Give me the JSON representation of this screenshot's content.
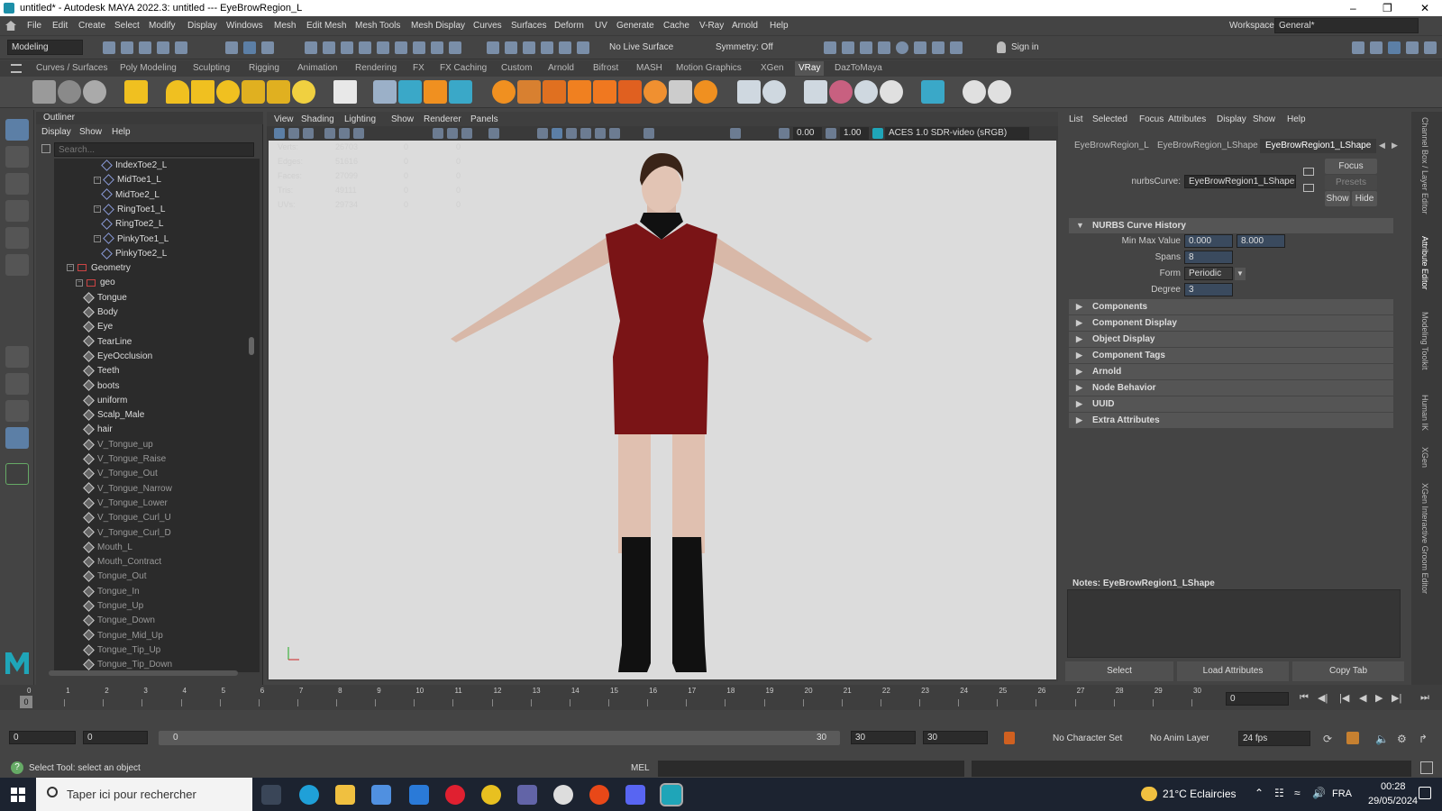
{
  "window": {
    "title": "untitled* - Autodesk MAYA 2022.3: untitled  ---  EyeBrowRegion_L",
    "minimize": "–",
    "maximize": "❐",
    "close": "✕"
  },
  "menubar": [
    "File",
    "Edit",
    "Create",
    "Select",
    "Modify",
    "Display",
    "Windows",
    "Mesh",
    "Edit Mesh",
    "Mesh Tools",
    "Mesh Display",
    "Curves",
    "Surfaces",
    "Deform",
    "UV",
    "Generate",
    "Cache",
    "V-Ray",
    "Arnold",
    "Help"
  ],
  "workspace": {
    "label": "Workspace:",
    "value": "General*"
  },
  "status": {
    "menuset": "Modeling",
    "live": "No Live Surface",
    "symmetry": "Symmetry: Off",
    "signin": "Sign in"
  },
  "shelf_tabs": [
    "Curves / Surfaces",
    "Poly Modeling",
    "Sculpting",
    "Rigging",
    "Animation",
    "Rendering",
    "FX",
    "FX Caching",
    "Custom",
    "Arnold",
    "Bifrost",
    "MASH",
    "Motion Graphics",
    "XGen",
    "VRay",
    "DazToMaya"
  ],
  "shelf_active": "VRay",
  "outliner": {
    "title": "Outliner",
    "menu": [
      "Display",
      "Show",
      "Help"
    ],
    "search_placeholder": "Search...",
    "items": [
      {
        "label": "IndexToe2_L",
        "type": "joint",
        "lvl": 5
      },
      {
        "label": "MidToe1_L",
        "type": "joint",
        "lvl": 4
      },
      {
        "label": "MidToe2_L",
        "type": "joint",
        "lvl": 5
      },
      {
        "label": "RingToe1_L",
        "type": "joint",
        "lvl": 4
      },
      {
        "label": "RingToe2_L",
        "type": "joint",
        "lvl": 5
      },
      {
        "label": "PinkyToe1_L",
        "type": "joint",
        "lvl": 4
      },
      {
        "label": "PinkyToe2_L",
        "type": "joint",
        "lvl": 5
      },
      {
        "label": "Geometry",
        "type": "group",
        "lvl": 1
      },
      {
        "label": "geo",
        "type": "group",
        "lvl": 2
      },
      {
        "label": "Tongue",
        "type": "mesh",
        "lvl": 3
      },
      {
        "label": "Body",
        "type": "mesh",
        "lvl": 3
      },
      {
        "label": "Eye",
        "type": "mesh",
        "lvl": 3
      },
      {
        "label": "TearLine",
        "type": "mesh",
        "lvl": 3
      },
      {
        "label": "EyeOcclusion",
        "type": "mesh",
        "lvl": 3
      },
      {
        "label": "Teeth",
        "type": "mesh",
        "lvl": 3
      },
      {
        "label": "boots",
        "type": "mesh",
        "lvl": 3
      },
      {
        "label": "uniform",
        "type": "mesh",
        "lvl": 3
      },
      {
        "label": "Scalp_Male",
        "type": "mesh",
        "lvl": 3
      },
      {
        "label": "hair",
        "type": "mesh",
        "lvl": 3
      },
      {
        "label": "V_Tongue_up",
        "type": "dim",
        "lvl": 3
      },
      {
        "label": "V_Tongue_Raise",
        "type": "dim",
        "lvl": 3
      },
      {
        "label": "V_Tongue_Out",
        "type": "dim",
        "lvl": 3
      },
      {
        "label": "V_Tongue_Narrow",
        "type": "dim",
        "lvl": 3
      },
      {
        "label": "V_Tongue_Lower",
        "type": "dim",
        "lvl": 3
      },
      {
        "label": "V_Tongue_Curl_U",
        "type": "dim",
        "lvl": 3
      },
      {
        "label": "V_Tongue_Curl_D",
        "type": "dim",
        "lvl": 3
      },
      {
        "label": "Mouth_L",
        "type": "dim",
        "lvl": 3
      },
      {
        "label": "Mouth_Contract",
        "type": "dim",
        "lvl": 3
      },
      {
        "label": "Tongue_Out",
        "type": "dim",
        "lvl": 3
      },
      {
        "label": "Tongue_In",
        "type": "dim",
        "lvl": 3
      },
      {
        "label": "Tongue_Up",
        "type": "dim",
        "lvl": 3
      },
      {
        "label": "Tongue_Down",
        "type": "dim",
        "lvl": 3
      },
      {
        "label": "Tongue_Mid_Up",
        "type": "dim",
        "lvl": 3
      },
      {
        "label": "Tongue_Tip_Up",
        "type": "dim",
        "lvl": 3
      },
      {
        "label": "Tongue_Tip_Down",
        "type": "dim",
        "lvl": 3
      }
    ]
  },
  "viewport": {
    "menu": [
      "View",
      "Shading",
      "Lighting",
      "Show",
      "Renderer",
      "Panels"
    ],
    "field1": "0.00",
    "field2": "1.00",
    "colorspace": "ACES 1.0 SDR-video (sRGB)",
    "hud": [
      {
        "k": "Verts:",
        "v": "26703",
        "a": "0",
        "b": "0"
      },
      {
        "k": "Edges:",
        "v": "51616",
        "a": "0",
        "b": "0"
      },
      {
        "k": "Faces:",
        "v": "27099",
        "a": "0",
        "b": "0"
      },
      {
        "k": "Tris:",
        "v": "49111",
        "a": "0",
        "b": "0"
      },
      {
        "k": "UVs:",
        "v": "29734",
        "a": "0",
        "b": "0"
      }
    ]
  },
  "attr": {
    "menu": [
      "List",
      "Selected",
      "Focus",
      "Attributes",
      "Display",
      "Show",
      "Help"
    ],
    "tabs": [
      "EyeBrowRegion_L",
      "EyeBrowRegion_LShape",
      "EyeBrowRegion1_LShape"
    ],
    "node_label": "nurbsCurve:",
    "node_value": "EyeBrowRegion1_LShape",
    "focus": "Focus",
    "presets": "Presets",
    "show": "Show",
    "hide": "Hide",
    "history_title": "NURBS Curve History",
    "fields": {
      "minmax_label": "Min Max Value",
      "min": "0.000",
      "max": "8.000",
      "spans_label": "Spans",
      "spans": "8",
      "form_label": "Form",
      "form": "Periodic",
      "degree_label": "Degree",
      "degree": "3"
    },
    "sections": [
      "Components",
      "Component Display",
      "Object Display",
      "Component Tags",
      "Arnold",
      "Node Behavior",
      "UUID",
      "Extra Attributes"
    ],
    "notes": "Notes:  EyeBrowRegion1_LShape",
    "buttons": [
      "Select",
      "Load Attributes",
      "Copy Tab"
    ]
  },
  "sidetabs": [
    "Channel Box / Layer Editor",
    "Attribute Editor",
    "Modeling Toolkit",
    "Human IK",
    "XGen",
    "XGen Interactive Groom Editor"
  ],
  "timeline": {
    "ticks": [
      "0",
      "1",
      "2",
      "3",
      "4",
      "5",
      "6",
      "7",
      "8",
      "9",
      "10",
      "11",
      "12",
      "13",
      "14",
      "15",
      "16",
      "17",
      "18",
      "19",
      "20",
      "21",
      "22",
      "23",
      "24",
      "25",
      "26",
      "27",
      "28",
      "29",
      "30"
    ],
    "current": "0",
    "frame_field": "0"
  },
  "range": {
    "start": "0",
    "start2": "0",
    "slider_start": "0",
    "slider_end": "30",
    "end": "30",
    "end2": "30",
    "charset": "No Character Set",
    "animlayer": "No Anim Layer",
    "fps": "24 fps"
  },
  "cmd": {
    "help": "Select Tool: select an object",
    "mel": "MEL"
  },
  "taskbar": {
    "search": "Taper ici pour rechercher",
    "weather": "21°C  Eclaircies",
    "lang": "FRA",
    "time": "00:28",
    "date": "29/05/2024"
  }
}
